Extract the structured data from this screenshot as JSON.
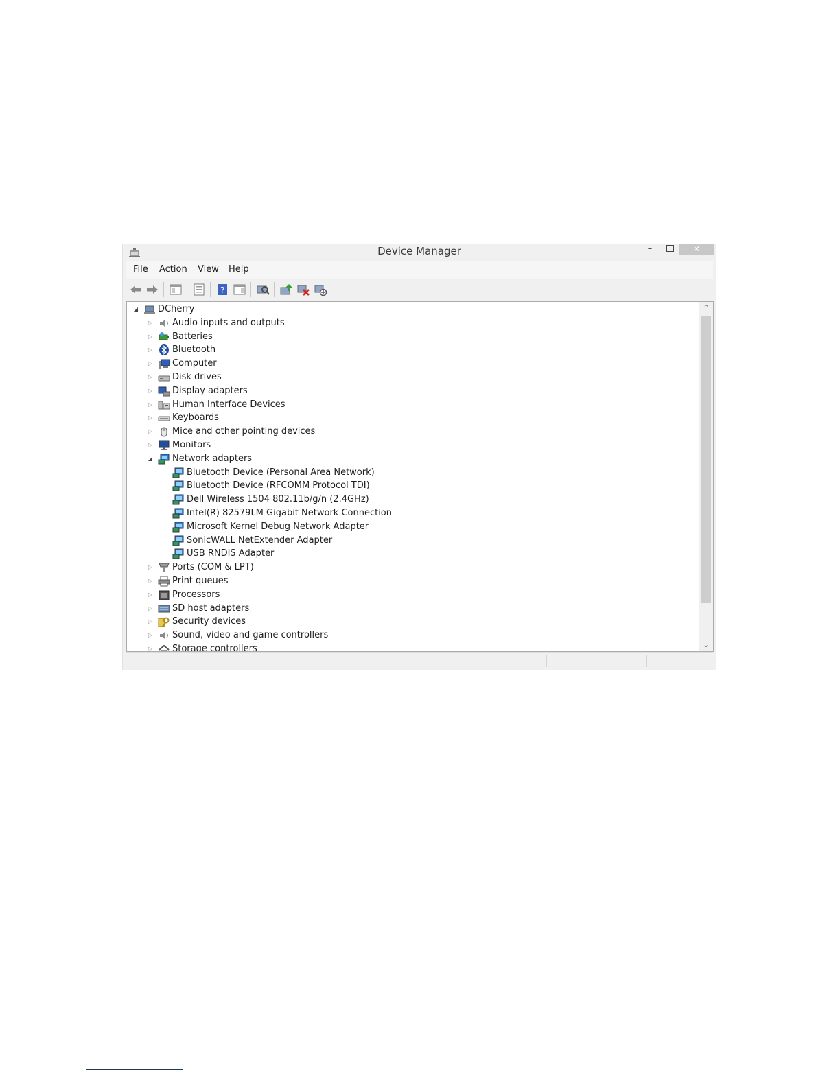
{
  "window": {
    "title": "Device Manager",
    "controls": {
      "minimize": "–",
      "close": "✕"
    }
  },
  "menu": [
    "File",
    "Action",
    "View",
    "Help"
  ],
  "toolbar": [
    "back-icon",
    "forward-icon",
    "console-tree-icon",
    "properties-icon",
    "help-icon",
    "action-pane-icon",
    "scan-hardware-icon",
    "update-driver-icon",
    "uninstall-device-icon",
    "disable-device-icon"
  ],
  "tree": {
    "root": {
      "label": "DCherry",
      "icon": "computer-desktop-icon",
      "expanded": true
    },
    "categories": [
      {
        "label": "Audio inputs and outputs",
        "icon": "speaker-icon",
        "expanded": false
      },
      {
        "label": "Batteries",
        "icon": "battery-icon",
        "expanded": false
      },
      {
        "label": "Bluetooth",
        "icon": "bluetooth-icon",
        "expanded": false
      },
      {
        "label": "Computer",
        "icon": "computer-icon",
        "expanded": false
      },
      {
        "label": "Disk drives",
        "icon": "disk-drive-icon",
        "expanded": false
      },
      {
        "label": "Display adapters",
        "icon": "display-adapter-icon",
        "expanded": false
      },
      {
        "label": "Human Interface Devices",
        "icon": "hid-icon",
        "expanded": false
      },
      {
        "label": "Keyboards",
        "icon": "keyboard-icon",
        "expanded": false
      },
      {
        "label": "Mice and other pointing devices",
        "icon": "mouse-icon",
        "expanded": false
      },
      {
        "label": "Monitors",
        "icon": "monitor-icon",
        "expanded": false
      },
      {
        "label": "Network adapters",
        "icon": "network-adapter-icon",
        "expanded": true,
        "children": [
          "Bluetooth Device (Personal Area Network)",
          "Bluetooth Device (RFCOMM Protocol TDI)",
          "Dell Wireless 1504 802.11b/g/n (2.4GHz)",
          "Intel(R) 82579LM Gigabit Network Connection",
          "Microsoft Kernel Debug Network Adapter",
          "SonicWALL NetExtender Adapter",
          "USB RNDIS Adapter"
        ]
      },
      {
        "label": "Ports (COM & LPT)",
        "icon": "port-icon",
        "expanded": false
      },
      {
        "label": "Print queues",
        "icon": "printer-icon",
        "expanded": false
      },
      {
        "label": "Processors",
        "icon": "processor-icon",
        "expanded": false
      },
      {
        "label": "SD host adapters",
        "icon": "sd-host-icon",
        "expanded": false
      },
      {
        "label": "Security devices",
        "icon": "security-key-icon",
        "expanded": false
      },
      {
        "label": "Sound, video and game controllers",
        "icon": "speaker-icon",
        "expanded": false
      },
      {
        "label": "Storage controllers",
        "icon": "storage-controller-icon",
        "expanded": false
      }
    ]
  },
  "scrollbar": {
    "up": "⌃",
    "down": "⌄"
  },
  "expander_glyphs": {
    "collapsed": "▷",
    "expanded": "◢"
  }
}
